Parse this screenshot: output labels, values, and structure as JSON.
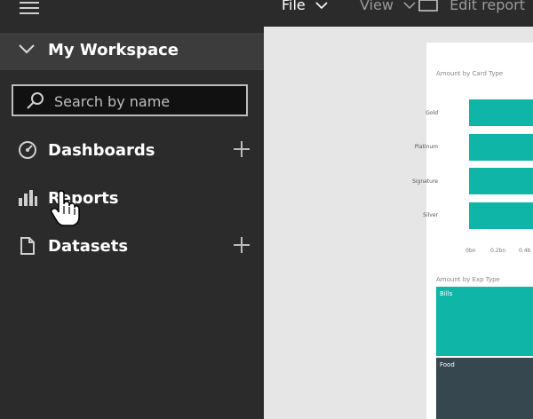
{
  "sidebar": {
    "workspace_title": "My Workspace",
    "search_placeholder": "Search by name",
    "items": [
      {
        "label": "Dashboards",
        "icon": "dashboard-icon",
        "has_add": true
      },
      {
        "label": "Reports",
        "icon": "bar-chart-icon",
        "has_add": false
      },
      {
        "label": "Datasets",
        "icon": "document-icon",
        "has_add": true
      }
    ]
  },
  "topbar": {
    "file": "File",
    "view": "View",
    "edit_report": "Edit report"
  },
  "report": {
    "chart1": {
      "title": "Amount by Card Type",
      "categories": [
        "Gold",
        "Platinum",
        "Signature",
        "Silver"
      ],
      "ticks": [
        "0bn",
        "0.2bn",
        "0.4b"
      ]
    },
    "chart2": {
      "title": "Amount by Exp Type",
      "tiles": [
        "Bills",
        "Food"
      ]
    }
  },
  "colors": {
    "accent": "#0fb5a6",
    "sidebar": "#2b2b2b",
    "dark_tile": "#37474f"
  }
}
